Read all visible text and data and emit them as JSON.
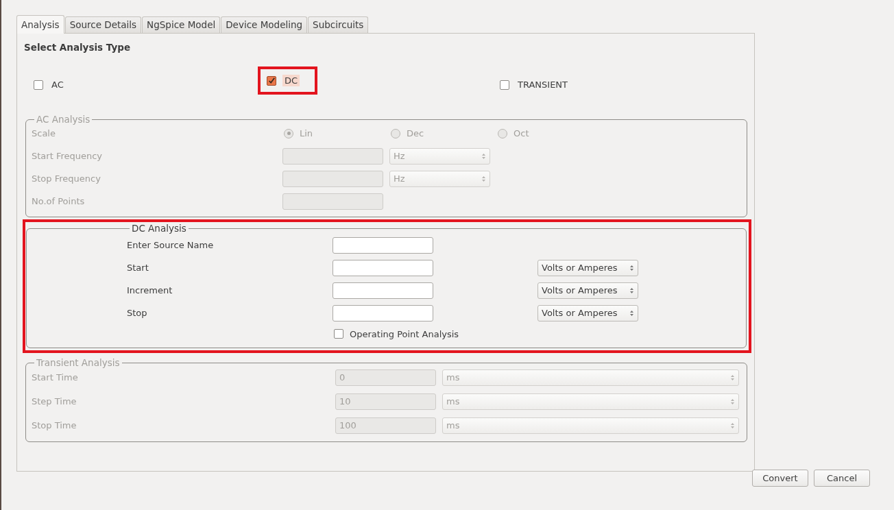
{
  "tabs": [
    {
      "label": "Analysis",
      "selected": true
    },
    {
      "label": "Source Details",
      "selected": false
    },
    {
      "label": "NgSpice Model",
      "selected": false
    },
    {
      "label": "Device Modeling",
      "selected": false
    },
    {
      "label": "Subcircuits",
      "selected": false
    }
  ],
  "section_title": "Select Analysis Type",
  "analysis_types": [
    {
      "label": "AC",
      "checked": false,
      "highlighted": false
    },
    {
      "label": "DC",
      "checked": true,
      "highlighted": true
    },
    {
      "label": "TRANSIENT",
      "checked": false,
      "highlighted": false
    }
  ],
  "groups": [
    {
      "title": "AC Analysis",
      "disabled": true,
      "highlighted": false,
      "rows": [
        {
          "kind": "radio",
          "label": "Scale",
          "options": [
            {
              "label": "Lin",
              "selected": true
            },
            {
              "label": "Dec",
              "selected": false
            },
            {
              "label": "Oct",
              "selected": false
            }
          ]
        },
        {
          "kind": "field",
          "label": "Start Frequency",
          "unit": "Hz"
        },
        {
          "kind": "field",
          "label": "Stop Frequency",
          "unit": "Hz"
        },
        {
          "kind": "field",
          "label": "No.of Points"
        }
      ]
    },
    {
      "title": "DC Analysis",
      "disabled": false,
      "highlighted": true,
      "rows": [
        {
          "kind": "field",
          "label": "Enter Source Name"
        },
        {
          "kind": "field",
          "label": "Start",
          "unit": "Volts or Amperes"
        },
        {
          "kind": "field",
          "label": "Increment",
          "unit": "Volts or Amperes"
        },
        {
          "kind": "field",
          "label": "Stop",
          "unit": "Volts or Amperes"
        },
        {
          "kind": "checkbox",
          "label": "Operating Point Analysis",
          "checked": false
        }
      ]
    },
    {
      "title": "Transient Analysis",
      "disabled": true,
      "highlighted": false,
      "rows": [
        {
          "kind": "field",
          "label": "Start Time",
          "value": "0",
          "unit": "ms"
        },
        {
          "kind": "field",
          "label": "Step Time",
          "value": "10",
          "unit": "ms"
        },
        {
          "kind": "field",
          "label": "Stop Time",
          "value": "100",
          "unit": "ms"
        }
      ]
    }
  ],
  "buttons": [
    "Convert",
    "Cancel"
  ]
}
